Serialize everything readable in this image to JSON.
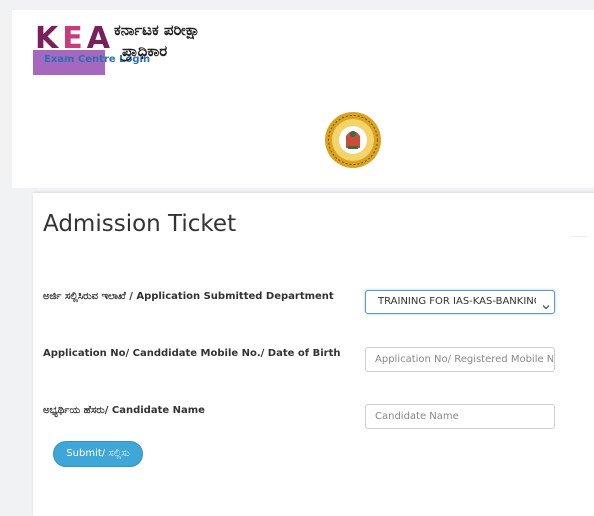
{
  "header": {
    "logo_text": "KEA",
    "exam_centre_link": "Exam Centre Login",
    "org_name_line1": "ಕರ್ನಾಟಕ ಪರೀಕ್ಷಾ",
    "org_name_line2": "ಪ್ರಾಧಿಕಾರ",
    "emblem_icon": "government-of-karnataka-emblem"
  },
  "form": {
    "title": "Admission Ticket",
    "department": {
      "label": "ಅರ್ಜಿ ಸಲ್ಲಿಸಿರುವ ಇಲಾಖೆ / Application Submitted Department",
      "selected": "TRAINING FOR IAS-KAS-BANKING"
    },
    "application_no": {
      "label": "Application No/ Canddidate Mobile No./ Date of Birth",
      "placeholder": "Application No/ Registered Mobile N"
    },
    "candidate_name": {
      "label": "ಅಭ್ಯರ್ಥಿಯ ಹೆಸರು/ Candidate Name",
      "placeholder": "Candidate Name"
    },
    "submit_label": "Submit/ ಸಲ್ಲಿಸು"
  },
  "colors": {
    "accent": "#3fa7d7",
    "logo_box": "#a667bf",
    "link": "#2a6fb8"
  }
}
